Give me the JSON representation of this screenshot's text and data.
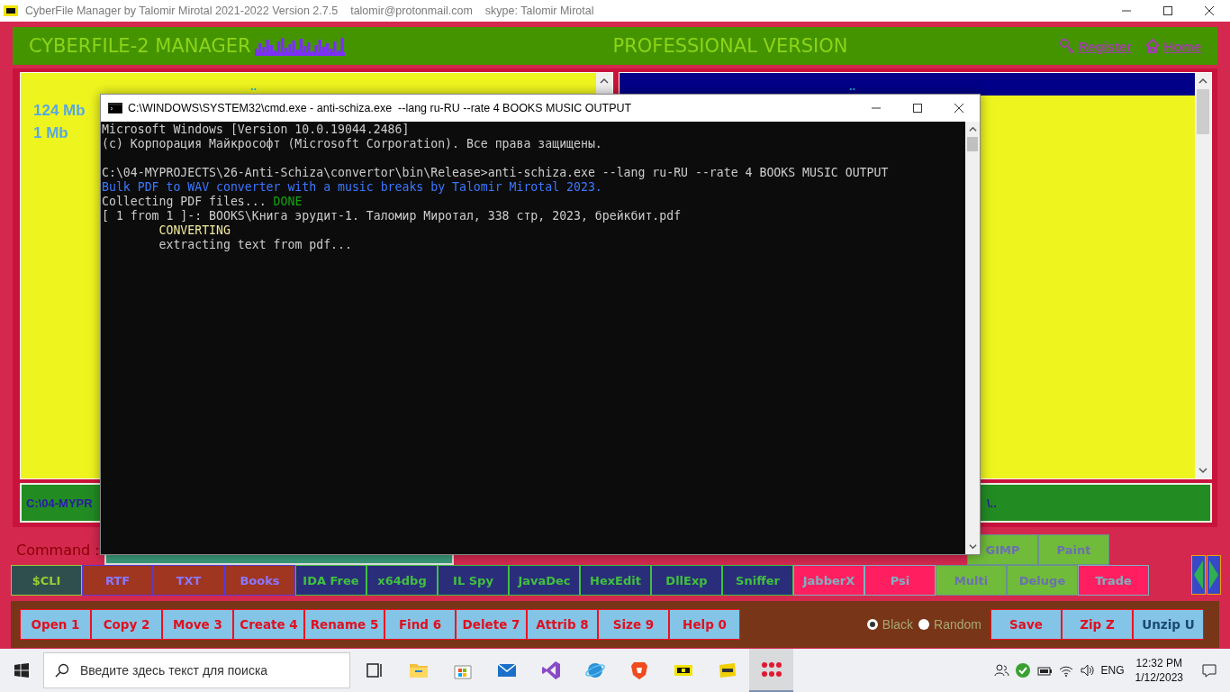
{
  "window": {
    "title": "CyberFile Manager by Talomir Mirotal 2021-2022 Version 2.7.5",
    "email": "talomir@protonmail.com",
    "skype": "skype: Talomir Mirotal"
  },
  "header": {
    "title": "CYBERFILE-2 MANAGER",
    "edition": "PROFESSIONAL VERSION",
    "links": [
      {
        "kind": "register",
        "label": "Register"
      },
      {
        "kind": "home",
        "label": "Home"
      }
    ]
  },
  "panels": [
    {
      "parent": "..",
      "header_active": false,
      "sizes": [
        "124 Mb",
        "1 Mb"
      ],
      "path": "C:\\04-MYPR"
    },
    {
      "parent": "..",
      "header_active": true,
      "path": "\\.."
    }
  ],
  "command": {
    "label": "Command :"
  },
  "tools_top": [
    {
      "label": "GIMP",
      "kind": "graphics"
    },
    {
      "label": "Paint",
      "kind": "graphics"
    }
  ],
  "tools": [
    {
      "label": "$CLI",
      "kind": "cli"
    },
    {
      "label": "RTF",
      "kind": "docs"
    },
    {
      "label": "TXT",
      "kind": "docs"
    },
    {
      "label": "Books",
      "kind": "docs"
    },
    {
      "label": "IDA Free",
      "kind": "dev"
    },
    {
      "label": "x64dbg",
      "kind": "dev"
    },
    {
      "label": "IL Spy",
      "kind": "dev"
    },
    {
      "label": "JavaDec",
      "kind": "dev"
    },
    {
      "label": "HexEdit",
      "kind": "dev"
    },
    {
      "label": "DllExp",
      "kind": "dev"
    },
    {
      "label": "Sniffer",
      "kind": "dev"
    },
    {
      "label": "JabberX",
      "kind": "net"
    },
    {
      "label": "Psi",
      "kind": "net"
    },
    {
      "label": "Multi",
      "kind": "graphics"
    },
    {
      "label": "Deluge",
      "kind": "graphics"
    },
    {
      "label": "Trade",
      "kind": "net"
    }
  ],
  "actions": [
    {
      "label": "Open 1",
      "kind": "file"
    },
    {
      "label": "Copy 2",
      "kind": "file"
    },
    {
      "label": "Move 3",
      "kind": "file"
    },
    {
      "label": "Create 4",
      "kind": "file"
    },
    {
      "label": "Rename 5",
      "kind": "file"
    },
    {
      "label": "Find 6",
      "kind": "file"
    },
    {
      "label": "Delete 7",
      "kind": "file"
    },
    {
      "label": "Attrib 8",
      "kind": "file"
    },
    {
      "label": "Size 9",
      "kind": "file"
    },
    {
      "label": "Help 0",
      "kind": "file"
    }
  ],
  "themes": [
    {
      "label": "Black",
      "selected": true
    },
    {
      "label": "Random",
      "selected": false
    }
  ],
  "archive": [
    {
      "label": "Save",
      "kind": "file"
    },
    {
      "label": "Zip Z",
      "kind": "file"
    },
    {
      "label": "Unzip U",
      "kind": "alt"
    }
  ],
  "console": {
    "title": "C:\\WINDOWS\\SYSTEM32\\cmd.exe - anti-schiza.exe  --lang ru-RU --rate 4 BOOKS MUSIC OUTPUT",
    "blocks": [
      {
        "lines": [
          {
            "parts": [
              {
                "text": "Microsoft Windows [Version 10.0.19044.2486]",
                "kind": "plain"
              }
            ]
          },
          {
            "parts": [
              {
                "text": "(c) Корпорация Майкрософт (Microsoft Corporation). Все права защищены.",
                "kind": "plain"
              }
            ]
          }
        ]
      },
      {
        "lines": [
          {
            "parts": [
              {
                "text": "C:\\04-MYPROJECTS\\26-Anti-Schiza\\convertor\\bin\\Release>anti-schiza.exe --lang ru-RU --rate 4 BOOKS MUSIC OUTPUT",
                "kind": "plain"
              }
            ]
          },
          {
            "parts": [
              {
                "text": "Bulk PDF to WAV converter with a music breaks by Talomir Mirotal 2023.",
                "kind": "info"
              }
            ]
          },
          {
            "parts": [
              {
                "text": "Collecting PDF files... ",
                "kind": "plain"
              },
              {
                "text": "DONE",
                "kind": "ok"
              }
            ]
          },
          {
            "parts": [
              {
                "text": "[ 1 from 1 ]-: BOOKS\\Книга эрудит-1. Таломир Миротал, 338 стр, 2023, брейкбит.pdf",
                "kind": "plain"
              }
            ]
          },
          {
            "parts": [
              {
                "text": "\tCONVERTING",
                "kind": "warn"
              }
            ]
          },
          {
            "parts": [
              {
                "text": "\textracting text from pdf...",
                "kind": "plain"
              }
            ]
          }
        ]
      }
    ]
  },
  "taskbar": {
    "search_placeholder": "Введите здесь текст для поиска",
    "apps": [
      {
        "kind": "taskview",
        "selected": false
      },
      {
        "kind": "folder",
        "selected": false
      },
      {
        "kind": "store",
        "selected": false
      },
      {
        "kind": "mail",
        "selected": false
      },
      {
        "kind": "studio",
        "selected": false
      },
      {
        "kind": "globe",
        "selected": false
      },
      {
        "kind": "lion",
        "selected": false
      },
      {
        "kind": "cyber",
        "selected": false
      },
      {
        "kind": "pdf",
        "selected": false
      },
      {
        "kind": "dots",
        "selected": true
      }
    ],
    "language": "ENG",
    "time": "12:32 PM",
    "date": "1/12/2023"
  }
}
